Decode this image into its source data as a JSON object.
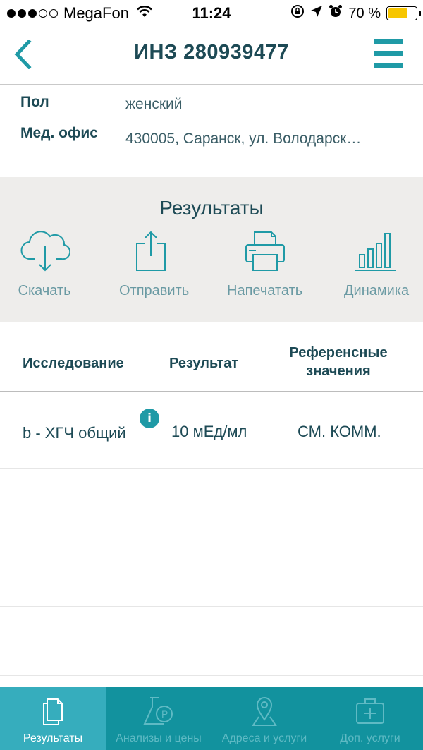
{
  "status": {
    "carrier": "MegaFon",
    "time": "11:24",
    "battery": "70 %",
    "battery_level": 0.7
  },
  "nav": {
    "title": "ИНЗ 280939477",
    "back_icon": "chevron-left-icon",
    "menu_icon": "hamburger-icon"
  },
  "info": {
    "gender_label": "Пол",
    "gender_value": "женский",
    "office_label": "Мед. офис",
    "office_value": "430005, Саранск, ул. Володарск…"
  },
  "results": {
    "title": "Результаты",
    "actions": [
      {
        "label": "Скачать",
        "icon": "cloud-download-icon"
      },
      {
        "label": "Отправить",
        "icon": "share-icon"
      },
      {
        "label": "Напечатать",
        "icon": "printer-icon"
      },
      {
        "label": "Динамика",
        "icon": "bar-chart-icon"
      }
    ]
  },
  "table": {
    "headers": [
      "Исследование",
      "Результат",
      "Референсные значения"
    ],
    "header_ref_line1": "Референсные",
    "header_ref_line2": "значения",
    "rows": [
      {
        "test": "b - ХГЧ общий",
        "result": "10 мЕд/мл",
        "reference": "СМ. КОММ.",
        "info_icon": "i"
      }
    ]
  },
  "tabs": [
    {
      "label": "Результаты",
      "icon": "document-icon",
      "active": true
    },
    {
      "label": "Анализы и цены",
      "icon": "flask-icon",
      "active": false
    },
    {
      "label": "Адреса и услуги",
      "icon": "map-pin-icon",
      "active": false
    },
    {
      "label": "Доп. услуги",
      "icon": "medical-kit-icon",
      "active": false
    }
  ],
  "colors": {
    "accent": "#1f9aa6",
    "tab_bar": "#12929e",
    "tab_active": "#36adbd",
    "text_dark": "#1d4a55"
  }
}
